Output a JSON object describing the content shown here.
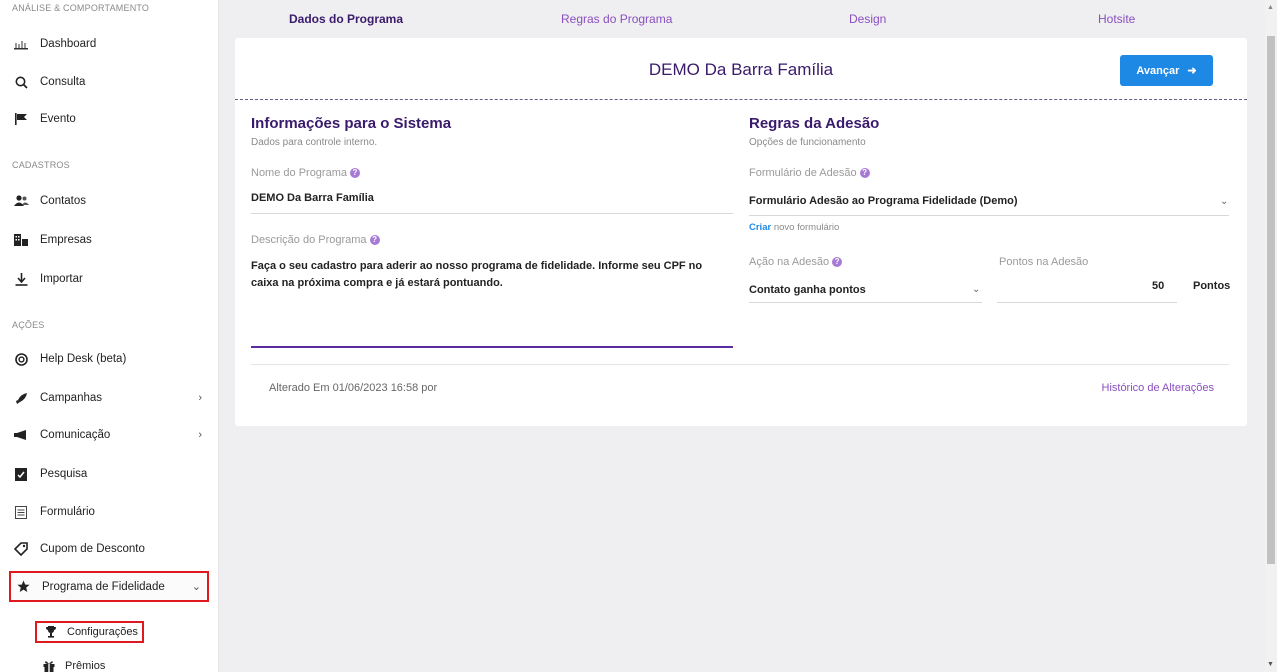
{
  "sidebar": {
    "sections": {
      "analise": "ANÁLISE & COMPORTAMENTO",
      "cadastros": "CADASTROS",
      "acoes": "AÇÕES"
    },
    "items": {
      "dashboard": "Dashboard",
      "consulta": "Consulta",
      "evento": "Evento",
      "contatos": "Contatos",
      "empresas": "Empresas",
      "importar": "Importar",
      "helpdesk": "Help Desk (beta)",
      "campanhas": "Campanhas",
      "comunicacao": "Comunicação",
      "pesquisa": "Pesquisa",
      "formulario": "Formulário",
      "cupom": "Cupom de Desconto",
      "fidelidade": "Programa de Fidelidade",
      "configuracoes": "Configurações",
      "premios": "Prêmios"
    }
  },
  "tabs": {
    "dados": "Dados do Programa",
    "regras": "Regras do Programa",
    "design": "Design",
    "hotsite": "Hotsite"
  },
  "header": {
    "title": "DEMO Da Barra Família",
    "next_label": "Avançar"
  },
  "left": {
    "title": "Informações para o Sistema",
    "subtitle": "Dados para controle interno.",
    "name_label": "Nome do Programa",
    "name_value": "DEMO Da Barra Família",
    "desc_label": "Descrição do Programa",
    "desc_value": "Faça o seu cadastro para aderir ao nosso programa de fidelidade. Informe seu CPF no caixa na próxima compra e já estará pontuando."
  },
  "right": {
    "title": "Regras da Adesão",
    "subtitle": "Opções de funcionamento",
    "form_label": "Formulário de Adesão",
    "form_value": "Formulário Adesão ao Programa Fidelidade (Demo)",
    "create_link": "Criar",
    "create_rest": "novo formulário",
    "action_label": "Ação na Adesão",
    "action_value": "Contato ganha pontos",
    "points_label": "Pontos na Adesão",
    "points_value": "50",
    "points_unit": "Pontos"
  },
  "footer": {
    "changed": "Alterado Em 01/06/2023 16:58 por",
    "history": "Histórico de Alterações"
  },
  "colors": {
    "accent": "#3a1a6b",
    "link": "#8a4fbf",
    "primary_button": "#1e88e5",
    "highlight_border": "#e0191e"
  }
}
